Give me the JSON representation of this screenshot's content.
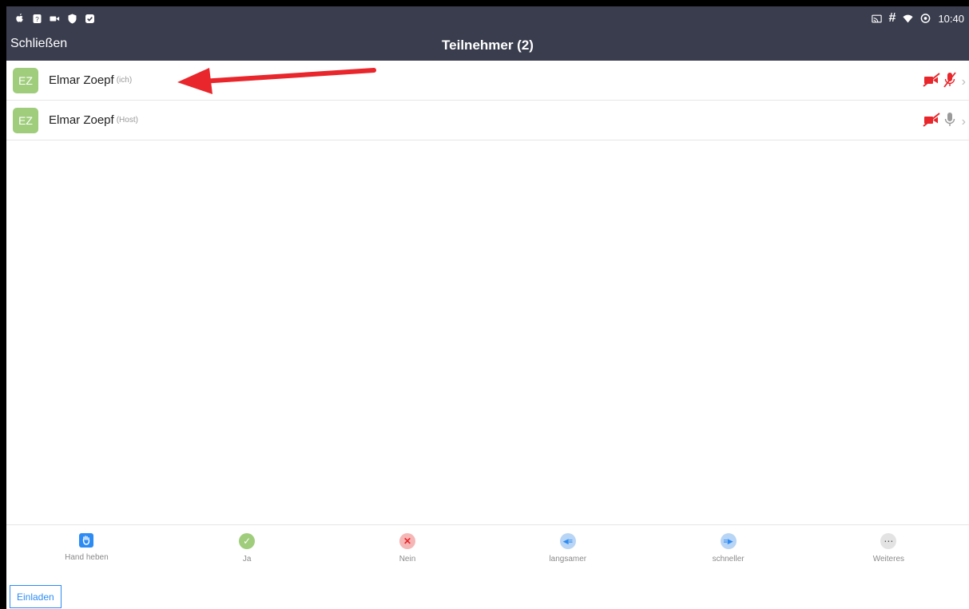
{
  "status_bar": {
    "time": "10:40",
    "left_icons": [
      "apple-icon",
      "shield-question-icon",
      "video-camera-icon",
      "shield-icon",
      "shield-check-icon"
    ],
    "right_icons": [
      "cast-icon",
      "hash-icon",
      "wifi-icon",
      "data-saver-icon"
    ],
    "hash_symbol": "#"
  },
  "header": {
    "close_label": "Schließen",
    "title": "Teilnehmer (2)",
    "background": "#3a3d4e"
  },
  "participants": [
    {
      "initials": "EZ",
      "name": "Elmar Zoepf",
      "tag": "(ich)",
      "video": "off",
      "audio": "muted"
    },
    {
      "initials": "EZ",
      "name": "Elmar Zoepf",
      "tag": "(Host)",
      "video": "off",
      "audio": "on"
    }
  ],
  "annotation": {
    "type": "red-arrow",
    "color": "#e8262b"
  },
  "toolbar": {
    "items": [
      {
        "label": "Hand heben",
        "icon": "raise-hand-icon",
        "color": "#2c8cf4"
      },
      {
        "label": "Ja",
        "icon": "check-icon",
        "color": "#9fcd7c"
      },
      {
        "label": "Nein",
        "icon": "x-icon",
        "color": "#f5b6b6"
      },
      {
        "label": "langsamer",
        "icon": "rewind-icon",
        "color": "#b8d5f5"
      },
      {
        "label": "schneller",
        "icon": "fast-forward-icon",
        "color": "#b8d5f5"
      },
      {
        "label": "Weiteres",
        "icon": "more-icon",
        "color": "#e3e3e3"
      }
    ]
  },
  "invite_label": "Einladen",
  "colors": {
    "accent": "#2c8cf4",
    "avatar": "#9fcd7c",
    "muted_red": "#e8262b"
  }
}
